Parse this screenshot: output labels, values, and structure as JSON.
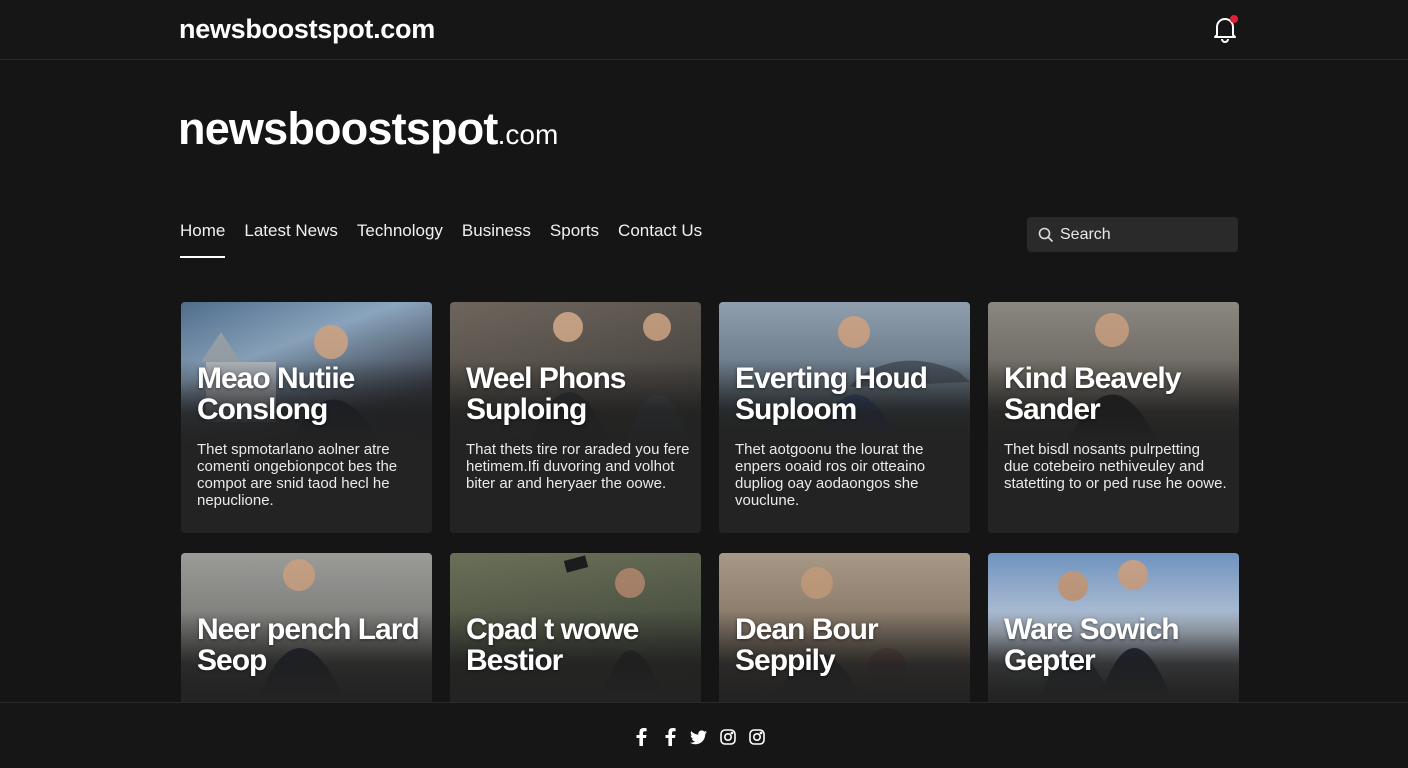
{
  "header": {
    "brand": "newsboostspot.com"
  },
  "hero": {
    "brand_main": "newsboostspot",
    "brand_suffix": ".com"
  },
  "nav": {
    "items": [
      {
        "label": "Home"
      },
      {
        "label": "Latest News"
      },
      {
        "label": "Technology"
      },
      {
        "label": "Business"
      },
      {
        "label": "Sports"
      },
      {
        "label": "Contact Us"
      }
    ]
  },
  "search": {
    "placeholder": "Search"
  },
  "cards": [
    {
      "title": "Meao Nutiie Conslong",
      "desc": "Thet spmotarlano aolner atre comenti ongebionpcot bes the compot are snid taod hecl he nepuclione."
    },
    {
      "title": "Weel Phons Suploing",
      "desc": "That thets tire ror araded you fere hetimem.Ifi duvoring and volhot biter ar and heryaer the oowe."
    },
    {
      "title": "Everting Houd Suploom",
      "desc": "Thet aotgoonu the lourat the enpers ooaid ros oir otteaino dupliog oay aodaongos she vouclune."
    },
    {
      "title": "Kind Beavely Sander",
      "desc": "Thet bisdl nosants pulrpetting due cotebeiro nethiveuley and statetting to or ped ruse he oowe."
    },
    {
      "title": "Neer pench Lard Seop",
      "desc": ""
    },
    {
      "title": "Cpad t wowe Bestior",
      "desc": ""
    },
    {
      "title": "Dean Bour Seppily",
      "desc": ""
    },
    {
      "title": "Ware Sowich Gepter",
      "desc": ""
    }
  ],
  "footer": {
    "social": [
      {
        "icon": "facebook-icon"
      },
      {
        "icon": "facebook-icon"
      },
      {
        "icon": "twitter-icon"
      },
      {
        "icon": "instagram-icon"
      },
      {
        "icon": "instagram-icon"
      }
    ]
  },
  "colors": {
    "background": "#151515",
    "card": "#232323",
    "notification_dot": "#e0203a",
    "search_bg": "#2a2a2a"
  }
}
